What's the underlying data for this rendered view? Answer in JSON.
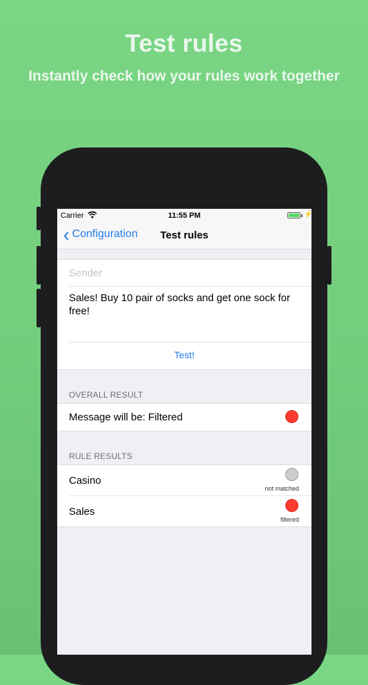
{
  "hero": {
    "title": "Test rules",
    "subtitle": "Instantly check how your rules work together"
  },
  "status_bar": {
    "carrier": "Carrier",
    "time": "11:55 PM",
    "wifi_icon": "wifi-icon",
    "battery_icon": "battery-charging-icon",
    "battery_level": 1.0
  },
  "nav": {
    "back_label": "Configuration",
    "title": "Test rules"
  },
  "form": {
    "sender_placeholder": "Sender",
    "sender_value": "",
    "message": "Sales! Buy 10 pair of socks and get one sock for free!",
    "test_button": "Test!"
  },
  "overall": {
    "header": "OVERALL RESULT",
    "label": "Message will be: Filtered",
    "status_color": "#ff3b30"
  },
  "rules": {
    "header": "RULE RESULTS",
    "items": [
      {
        "name": "Casino",
        "status": "not matched",
        "color": "#cccccc"
      },
      {
        "name": "Sales",
        "status": "filtered",
        "color": "#ff3b30"
      }
    ]
  },
  "colors": {
    "background": "#77d382",
    "accent": "#1f7ce8",
    "filtered": "#ff3b30",
    "not_matched": "#cccccc"
  }
}
